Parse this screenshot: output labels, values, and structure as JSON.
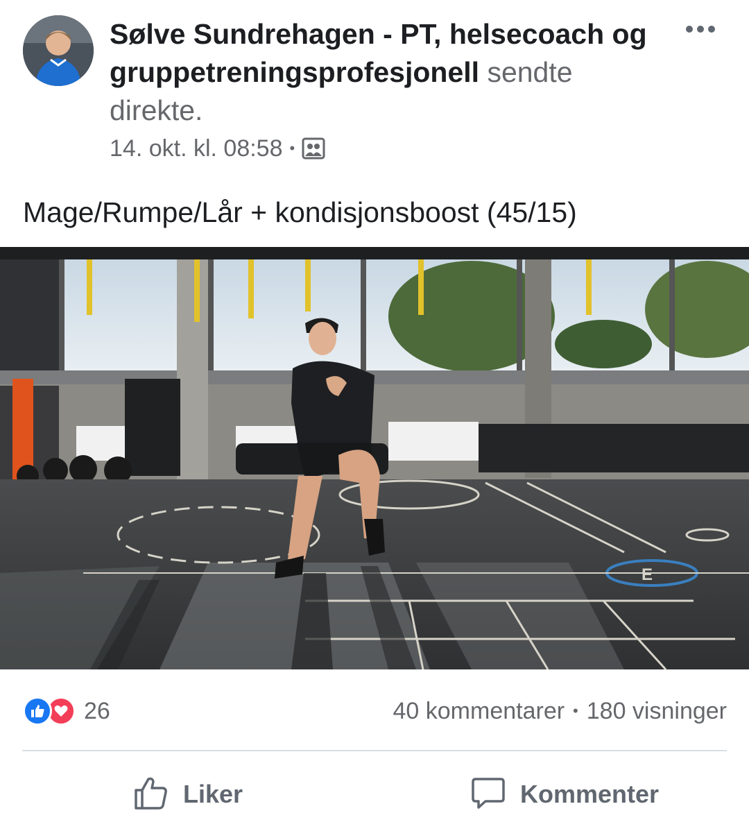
{
  "post": {
    "author": "Sølve Sundrehagen - PT, helsecoach og gruppetreningsprofesjonell",
    "action": "sendte direkte.",
    "timestamp": "14. okt. kl. 08:58",
    "separator": "•",
    "audience_icon": "group-audience-icon",
    "text": "Mage/Rumpe/Lår + kondisjonsboost (45/15)"
  },
  "stats": {
    "reactions_count": "26",
    "comments": "40 kommentarer",
    "separator": "•",
    "views": "180 visninger",
    "reaction_icons": [
      "like-reaction-icon",
      "love-reaction-icon"
    ]
  },
  "actions": {
    "like_label": "Liker",
    "comment_label": "Kommenter"
  },
  "colors": {
    "text_primary": "#1c1e21",
    "text_secondary": "#65676b",
    "like_blue": "#1877f2",
    "love_red": "#f33e58",
    "divider": "#dadde1"
  }
}
